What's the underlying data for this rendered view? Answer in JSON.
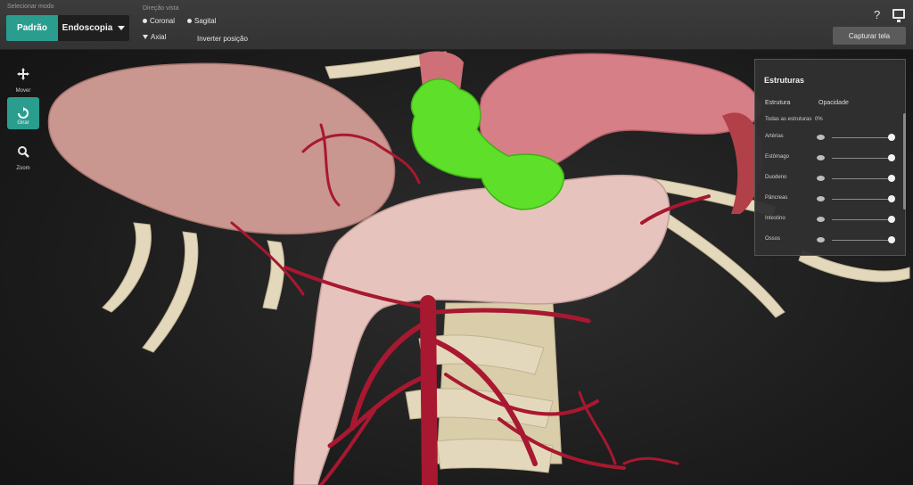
{
  "header": {
    "mode_label": "Selecionar modo",
    "mode_active": "Padrão",
    "mode_select": "Endoscopia",
    "view_label": "Direção vista",
    "view_options": [
      "Coronal",
      "Sagital",
      "Axial",
      "Inverter posição"
    ],
    "capture_label": "Capturar tela",
    "help_label": "?"
  },
  "toolbar": {
    "items": [
      {
        "icon": "move-icon",
        "label": "Mover"
      },
      {
        "icon": "rotate-icon",
        "label": "Girar"
      },
      {
        "icon": "zoom-icon",
        "label": "Zoom"
      }
    ]
  },
  "structures_panel": {
    "title": "Estruturas",
    "col_structure": "Estrutura",
    "col_opacity": "Opacidade",
    "all_label": "Todas as estruturas",
    "all_value": "0%",
    "rows": [
      {
        "name": "Artérias",
        "opacity": 100
      },
      {
        "name": "Estômago",
        "opacity": 100
      },
      {
        "name": "Duodeno",
        "opacity": 100
      },
      {
        "name": "Pâncreas",
        "opacity": 100
      },
      {
        "name": "Intestino",
        "opacity": 100
      },
      {
        "name": "Ossos",
        "opacity": 100
      }
    ]
  },
  "colors": {
    "accent": "#2a9d8f",
    "vessels": "#b01830",
    "tumor": "#5ee02a",
    "bone": "#e6dcc0",
    "organ": "#c99690"
  }
}
